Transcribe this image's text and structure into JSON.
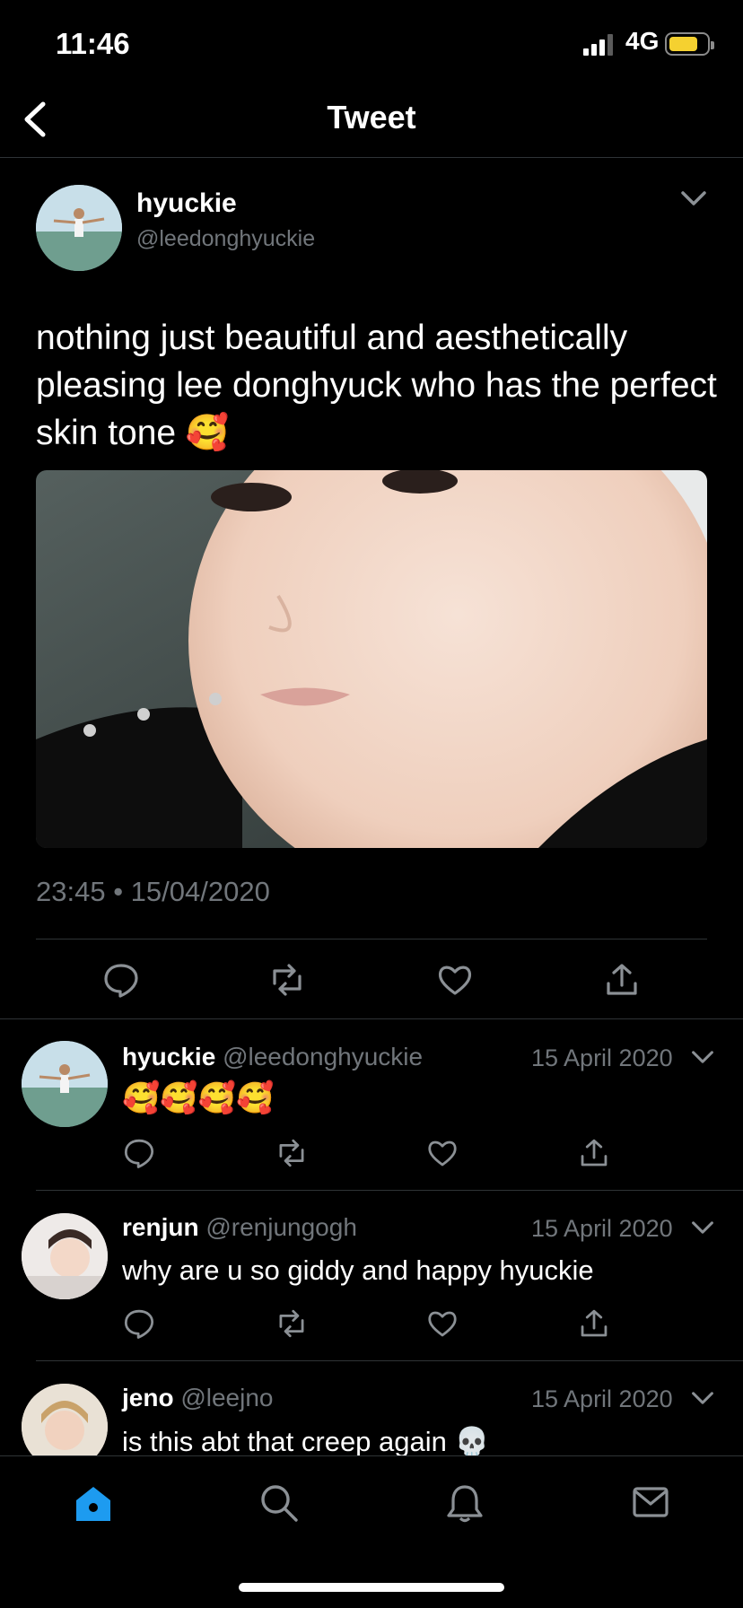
{
  "status_bar": {
    "time": "11:46",
    "network": "4G"
  },
  "header": {
    "title": "Tweet"
  },
  "main_tweet": {
    "name": "hyuckie",
    "handle": "@leedonghyuckie",
    "text": "nothing just beautiful and aesthetically pleasing lee donghyuck who has the perfect skin tone 🥰",
    "timestamp": "23:45 • 15/04/2020"
  },
  "replies": [
    {
      "name": "hyuckie",
      "handle": "@leedonghyuckie",
      "date": "15 April 2020",
      "text": "🥰🥰🥰🥰"
    },
    {
      "name": "renjun",
      "handle": "@renjungogh",
      "date": "15 April 2020",
      "text": "why are u so giddy and happy hyuckie"
    },
    {
      "name": "jeno",
      "handle": "@leejno",
      "date": "15 April 2020",
      "text": "is this abt that creep again 💀"
    }
  ],
  "colors": {
    "background": "#000000",
    "accent": "#1d9bf0",
    "muted": "#71767b",
    "divider": "#2f3336"
  },
  "tabs": [
    {
      "icon": "home-icon",
      "active": true
    },
    {
      "icon": "search-icon",
      "active": false
    },
    {
      "icon": "bell-icon",
      "active": false
    },
    {
      "icon": "mail-icon",
      "active": false
    }
  ]
}
